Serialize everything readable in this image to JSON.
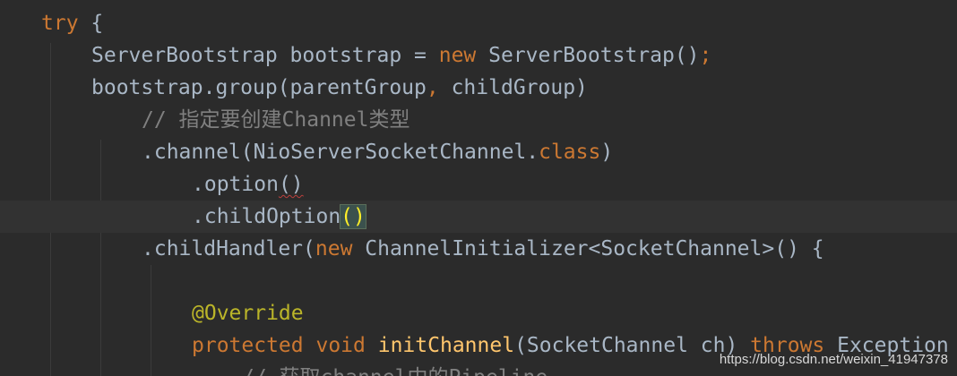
{
  "editor": {
    "lines": [
      {
        "indent": 0,
        "tokens": [
          {
            "text": "try",
            "cls": "kw"
          },
          {
            "text": " {",
            "cls": "plain"
          }
        ]
      },
      {
        "indent": 1,
        "tokens": [
          {
            "text": "ServerBootstrap bootstrap = ",
            "cls": "plain"
          },
          {
            "text": "new",
            "cls": "kw"
          },
          {
            "text": " ServerBootstrap()",
            "cls": "plain"
          },
          {
            "text": ";",
            "cls": "kw"
          }
        ]
      },
      {
        "indent": 1,
        "tokens": [
          {
            "text": "bootstrap.group(parentGroup",
            "cls": "plain"
          },
          {
            "text": ",",
            "cls": "kw"
          },
          {
            "text": " childGroup)",
            "cls": "plain"
          }
        ]
      },
      {
        "indent": 2,
        "tokens": [
          {
            "text": "// 指定要创建Channel类型",
            "cls": "cmt"
          }
        ]
      },
      {
        "indent": 2,
        "tokens": [
          {
            "text": ".channel(NioServerSocketChannel.",
            "cls": "plain"
          },
          {
            "text": "class",
            "cls": "kw"
          },
          {
            "text": ")",
            "cls": "plain"
          }
        ]
      },
      {
        "indent": 3,
        "tokens": [
          {
            "text": ".option",
            "cls": "plain"
          },
          {
            "text": "()",
            "cls": "plain warn"
          }
        ]
      },
      {
        "indent": 3,
        "current": true,
        "tokens": [
          {
            "text": ".childOption",
            "cls": "plain"
          },
          {
            "text": "()",
            "cls": "match"
          }
        ]
      },
      {
        "indent": 2,
        "tokens": [
          {
            "text": ".childHandler(",
            "cls": "plain"
          },
          {
            "text": "new",
            "cls": "kw"
          },
          {
            "text": " ChannelInitializer<SocketChannel>() {",
            "cls": "plain"
          }
        ]
      },
      {
        "indent": 3,
        "tokens": []
      },
      {
        "indent": 3,
        "tokens": [
          {
            "text": "@Override",
            "cls": "ann"
          }
        ]
      },
      {
        "indent": 3,
        "tokens": [
          {
            "text": "protected",
            "cls": "kw"
          },
          {
            "text": " ",
            "cls": "plain"
          },
          {
            "text": "void",
            "cls": "kw"
          },
          {
            "text": " ",
            "cls": "plain"
          },
          {
            "text": "initChannel",
            "cls": "fn"
          },
          {
            "text": "(SocketChannel ch) ",
            "cls": "plain"
          },
          {
            "text": "throws",
            "cls": "kw"
          },
          {
            "text": " Exception {",
            "cls": "plain"
          }
        ]
      },
      {
        "indent": 4,
        "tokens": [
          {
            "text": "// 获取channel中的Pipeline",
            "cls": "cmt"
          }
        ]
      }
    ]
  },
  "watermark": {
    "text": "https://blog.csdn.net/weixin_41947378"
  }
}
